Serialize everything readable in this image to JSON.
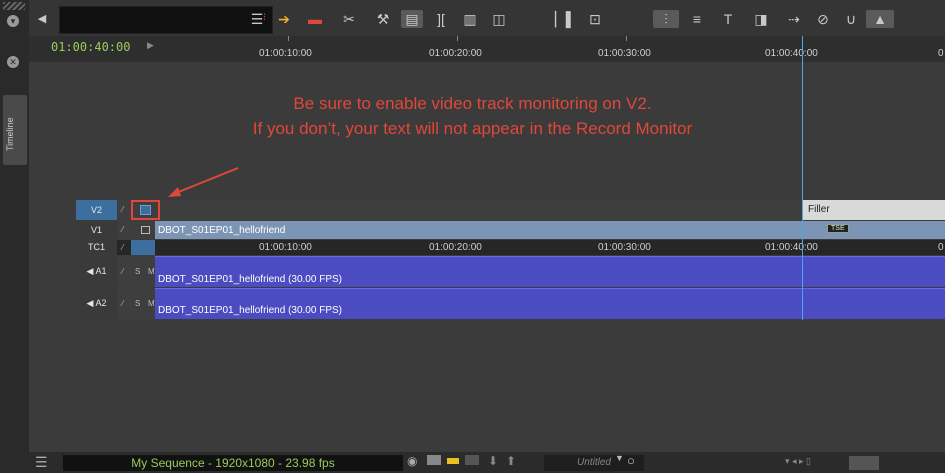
{
  "ruler": {
    "timecode": "01:00:40:00",
    "ticks": [
      "01:00:10:00",
      "01:00:20:00",
      "01:00:30:00",
      "01:00:40:00",
      "0"
    ]
  },
  "annotation": {
    "line1": "Be sure to enable video track monitoring on V2.",
    "line2": "If you don’t, your text will not appear in the Record Monitor"
  },
  "side": {
    "timeline_tab": "Timeline"
  },
  "tracks": {
    "v2": {
      "label": "V2",
      "filler": "Filler"
    },
    "v1": {
      "label": "V1",
      "clip": "DBOT_S01EP01_hellofriend",
      "badge": "TSE"
    },
    "tc1": {
      "label": "TC1",
      "ticks": [
        "01:00:10:00",
        "01:00:20:00",
        "01:00:30:00",
        "01:00:40:00",
        "0"
      ]
    },
    "a1": {
      "label": "A1",
      "clip": "DBOT_S01EP01_hellofriend (30.00 FPS)",
      "solo": "S",
      "mute": "M"
    },
    "a2": {
      "label": "A2",
      "clip": "DBOT_S01EP01_hellofriend (30.00 FPS)",
      "solo": "S",
      "mute": "M"
    }
  },
  "bottom": {
    "sequence": "My Sequence - 1920x1080 - 23.98 fps",
    "bin": "Untitled"
  },
  "colors": {
    "annotation": "#e0473a",
    "audio_clip": "#4b4cc2",
    "video_clip": "#7d95b5",
    "playhead": "#4aa8e8"
  }
}
